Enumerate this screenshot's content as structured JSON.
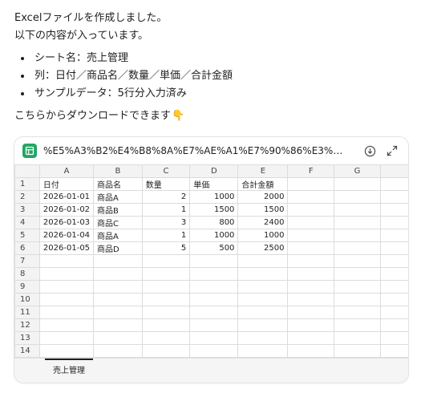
{
  "message": {
    "line1": "Excelファイルを作成しました。",
    "line2": "以下の内容が入っています。",
    "bullets": [
      "シート名：売上管理",
      "列：日付／商品名／数量／単価／合計金額",
      "サンプルデータ：5行分入力済み"
    ],
    "closing": "こちらからダウンロードできます",
    "closing_emoji": "👇"
  },
  "file": {
    "name": "%E5%A3%B2%E4%B8%8A%E7%AE%A1%E7%90%86%E3%82%B5..."
  },
  "sheet": {
    "col_headers": [
      "A",
      "B",
      "C",
      "D",
      "E",
      "F",
      "G"
    ],
    "row_numbers": [
      "1",
      "2",
      "3",
      "4",
      "5",
      "6",
      "7",
      "8",
      "9",
      "10",
      "11",
      "12",
      "13",
      "14"
    ],
    "header_row": [
      "日付",
      "商品名",
      "数量",
      "単価",
      "合計金額",
      "",
      ""
    ],
    "rows": [
      [
        "2026-01-01",
        "商品A",
        "2",
        "1000",
        "2000",
        "",
        ""
      ],
      [
        "2026-01-02",
        "商品B",
        "1",
        "1500",
        "1500",
        "",
        ""
      ],
      [
        "2026-01-03",
        "商品C",
        "3",
        "800",
        "2400",
        "",
        ""
      ],
      [
        "2026-01-04",
        "商品A",
        "1",
        "1000",
        "1000",
        "",
        ""
      ],
      [
        "2026-01-05",
        "商品D",
        "5",
        "500",
        "2500",
        "",
        ""
      ]
    ],
    "tab_name": "売上管理"
  },
  "colors": {
    "sheet_icon": "#23a566"
  }
}
